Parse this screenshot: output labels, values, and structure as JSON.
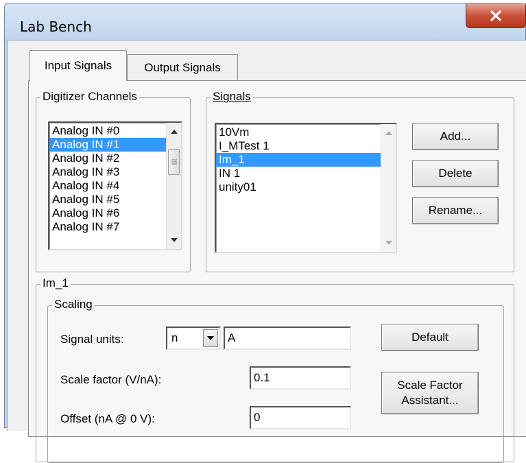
{
  "window": {
    "title": "Lab Bench"
  },
  "tabs": [
    {
      "label": "Input Signals",
      "active": true
    },
    {
      "label": "Output Signals",
      "active": false
    }
  ],
  "digitizer": {
    "legend": "Digitizer Channels",
    "items": [
      "Analog IN #0",
      "Analog IN #1",
      "Analog IN #2",
      "Analog IN #3",
      "Analog IN #4",
      "Analog IN #5",
      "Analog IN #6",
      "Analog IN #7"
    ],
    "selected": "Analog IN #1"
  },
  "signals": {
    "legend": "Signals",
    "items": [
      "10Vm",
      "I_MTest 1",
      "Im_1",
      "IN 1",
      "unity01"
    ],
    "selected": "Im_1",
    "buttons": {
      "add": "Add...",
      "delete": "Delete",
      "rename": "Rename..."
    }
  },
  "signal_group": {
    "legend": "Im_1",
    "scaling": {
      "legend": "Scaling",
      "units_label": "Signal units:",
      "units_prefix": "n",
      "units_value": "A",
      "scale_label": "Scale factor (V/nA):",
      "scale_value": "0.1",
      "offset_label": "Offset (nA @ 0 V):",
      "offset_value": "0",
      "default_button": "Default",
      "assistant_button_line1": "Scale Factor",
      "assistant_button_line2": "Assistant..."
    }
  },
  "colors": {
    "selection": "#3399ff",
    "close_button": "#c8523b"
  }
}
